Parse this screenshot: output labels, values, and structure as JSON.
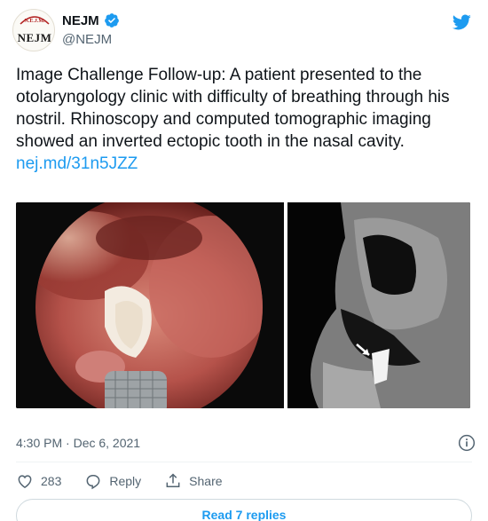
{
  "tweet": {
    "author": {
      "name": "NEJM",
      "handle": "@NEJM",
      "avatar_text": "NEJM",
      "avatar_seal_text": "NEW ENGLAND JOURNAL"
    },
    "text": "Image Challenge Follow-up: A patient presented to the otolaryngology clinic with difficulty of breathing through his nostril. Rhinoscopy and computed tomographic imaging showed an inverted ectopic tooth in the nasal cavity.",
    "link": "nej.md/31n5JZZ",
    "timestamp": "4:30 PM · Dec 6, 2021",
    "likes": "283",
    "reply_label": "Reply",
    "share_label": "Share",
    "read_replies": "Read 7 replies"
  },
  "colors": {
    "link": "#1d9bf0",
    "muted": "#536471",
    "verified": "#1d9bf0"
  }
}
